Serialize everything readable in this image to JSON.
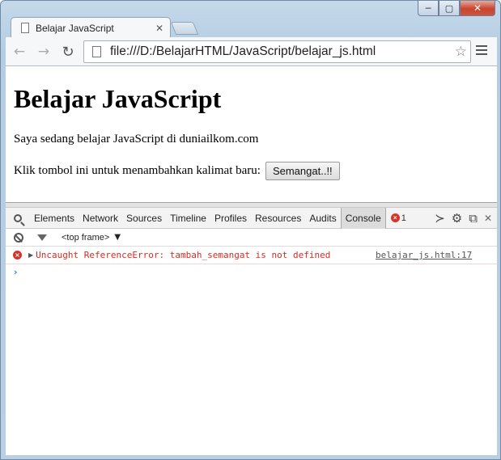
{
  "window": {
    "min_glyph": "─",
    "max_glyph": "▢",
    "close_glyph": "✕"
  },
  "tab": {
    "title": "Belajar JavaScript",
    "close_glyph": "✕"
  },
  "toolbar": {
    "back_glyph": "←",
    "forward_glyph": "→",
    "reload_glyph": "↻",
    "url": "file:///D:/BelajarHTML/JavaScript/belajar_js.html",
    "star_glyph": "☆"
  },
  "page": {
    "heading": "Belajar JavaScript",
    "paragraph": "Saya sedang belajar JavaScript di duniailkom.com",
    "prompt_text": "Klik tombol ini untuk menambahkan kalimat baru:",
    "button_label": "Semangat..!!"
  },
  "devtools": {
    "tabs": [
      "Elements",
      "Network",
      "Sources",
      "Timeline",
      "Profiles",
      "Resources",
      "Audits",
      "Console"
    ],
    "active_tab": "Console",
    "error_count": "1",
    "icons": {
      "drawer": "≻",
      "settings": "⚙",
      "dock": "⧉",
      "close": "✕"
    },
    "frame_selector": "<top frame>",
    "frame_arrow": "▼"
  },
  "console": {
    "error_message": "Uncaught ReferenceError: tambah_semangat is not defined",
    "error_source": "belajar_js.html:17",
    "prompt_glyph": "›"
  },
  "colors": {
    "error": "#e0281e",
    "prompt": "#2478ff",
    "frame": "#b9cfe3"
  }
}
